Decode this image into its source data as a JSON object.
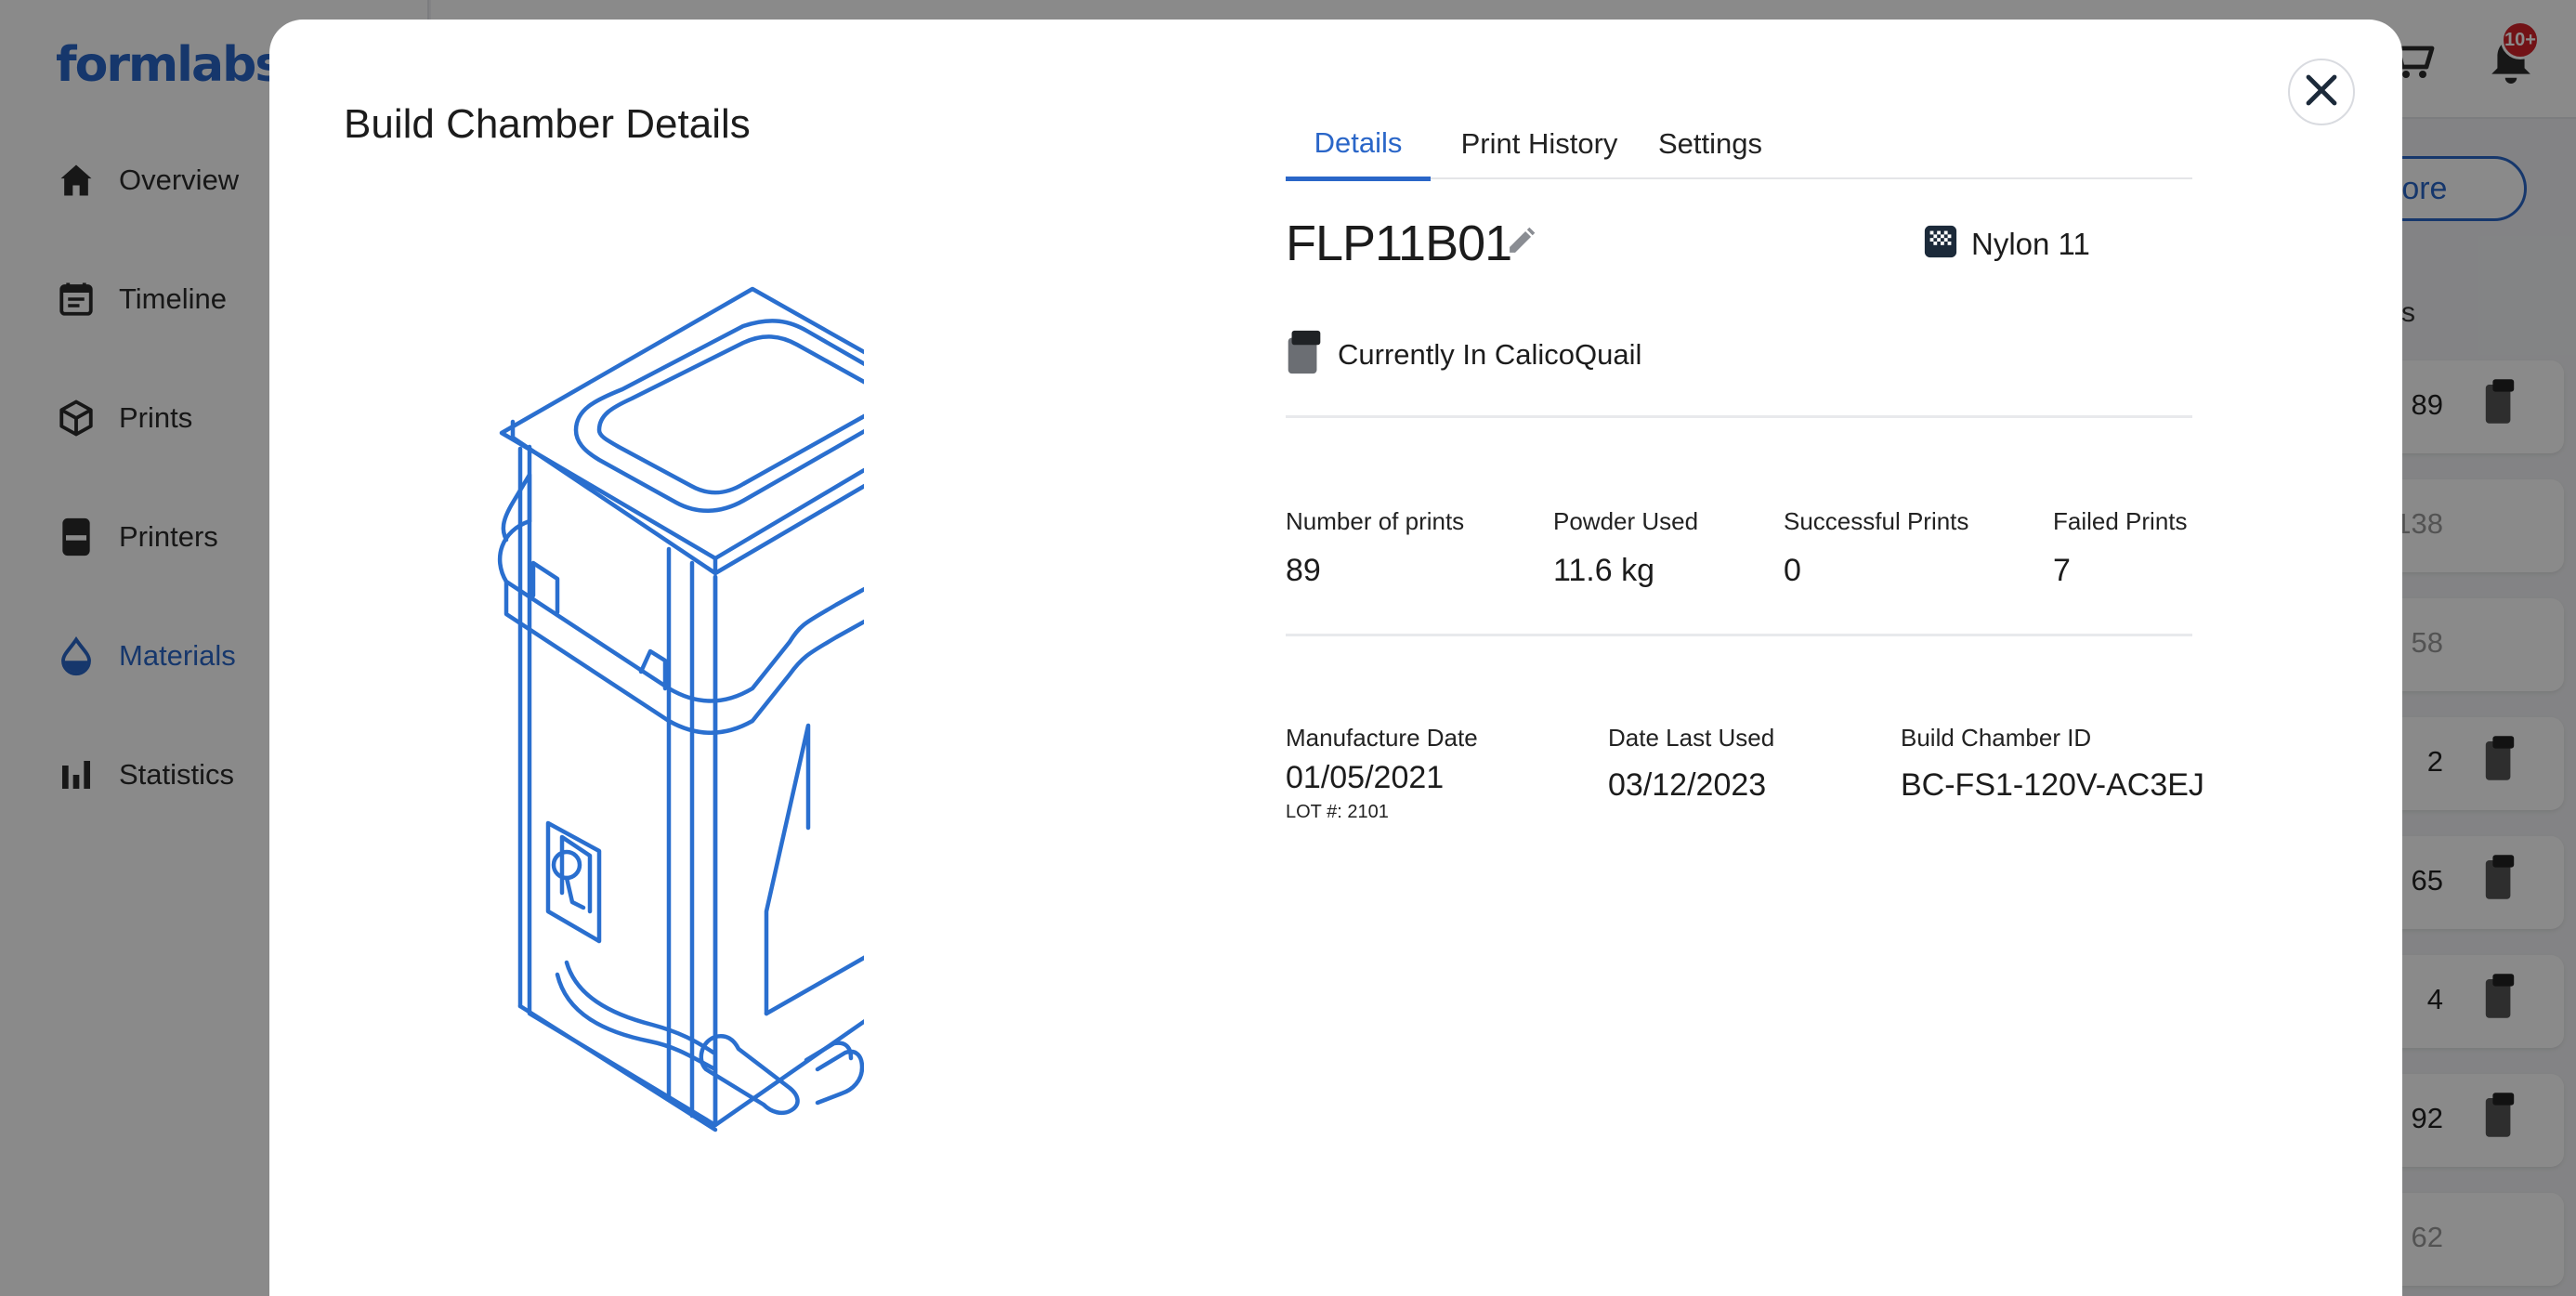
{
  "app": {
    "logo": "formlabs",
    "nav": [
      {
        "label": "Overview",
        "icon": "home-icon"
      },
      {
        "label": "Timeline",
        "icon": "calendar-icon"
      },
      {
        "label": "Prints",
        "icon": "cube-icon"
      },
      {
        "label": "Printers",
        "icon": "printer-icon"
      },
      {
        "label": "Materials",
        "icon": "droplet-icon",
        "active": true
      },
      {
        "label": "Statistics",
        "icon": "bar-chart-icon"
      }
    ],
    "notification_badge": "10+",
    "more_button": "More",
    "column_header_fragment": "nts",
    "row_values": [
      "89",
      "138",
      "58",
      "2",
      "65",
      "4",
      "92",
      "62"
    ],
    "accent_color": "#2a66c8"
  },
  "modal": {
    "title": "Build Chamber Details",
    "tabs": [
      {
        "label": "Details",
        "active": true
      },
      {
        "label": "Print History"
      },
      {
        "label": "Settings"
      }
    ],
    "chamber_name": "FLP11B01",
    "material": "Nylon 11",
    "location": "Currently In CalicoQuail",
    "stats": [
      {
        "label": "Number of prints",
        "value": "89"
      },
      {
        "label": "Powder Used",
        "value": "11.6 kg"
      },
      {
        "label": "Successful Prints",
        "value": "0"
      },
      {
        "label": "Failed Prints",
        "value": "7"
      }
    ],
    "info": {
      "manufacture_date_label": "Manufacture Date",
      "manufacture_date": "01/05/2021",
      "lot": "LOT #: 2101",
      "last_used_label": "Date Last Used",
      "last_used": "03/12/2023",
      "chamber_id_label": "Build Chamber ID",
      "chamber_id": "BC-FS1-120V-AC3EJ"
    }
  }
}
